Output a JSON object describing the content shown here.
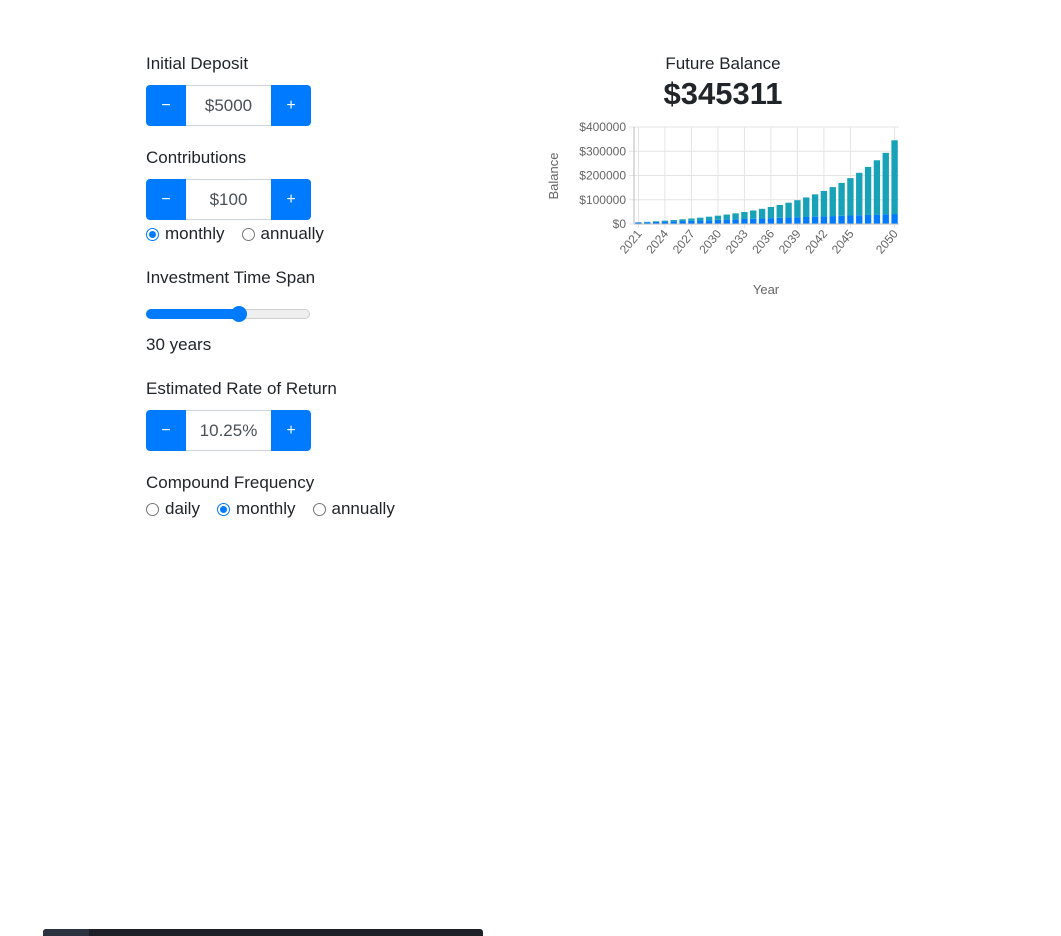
{
  "initial_deposit": {
    "label": "Initial Deposit",
    "value": "$5000",
    "minus_label": "−",
    "plus_label": "+"
  },
  "contributions": {
    "label": "Contributions",
    "value": "$100",
    "minus_label": "−",
    "plus_label": "+",
    "frequency_options": [
      "monthly",
      "annually"
    ],
    "selected_frequency": "monthly"
  },
  "time_span": {
    "label": "Investment Time Span",
    "years": 30,
    "value_text": "30 years",
    "slider_fraction": 0.56
  },
  "rate_of_return": {
    "label": "Estimated Rate of Return",
    "value": "10.25%",
    "minus_label": "−",
    "plus_label": "+"
  },
  "compound_frequency": {
    "label": "Compound Frequency",
    "options": [
      "daily",
      "monthly",
      "annually"
    ],
    "selected": "monthly"
  },
  "summary": {
    "label": "Future Balance",
    "value": "$345311"
  },
  "colors": {
    "accent": "#007bff",
    "principal_series": "#007bff",
    "interest_series": "#17a2b8"
  },
  "chart_data": {
    "type": "bar",
    "stacked": true,
    "xlabel": "Year",
    "ylabel": "Balance",
    "ylim": [
      0,
      400000
    ],
    "y_ticks": [
      "$0",
      "$100000",
      "$200000",
      "$300000",
      "$400000"
    ],
    "y_tick_values": [
      0,
      100000,
      200000,
      300000,
      400000
    ],
    "x_tick_labels": [
      "2021",
      "2024",
      "2027",
      "2030",
      "2033",
      "2036",
      "2039",
      "2042",
      "2045",
      "2050"
    ],
    "x_tick_categories": [
      "2021",
      "2024",
      "2027",
      "2030",
      "2033",
      "2036",
      "2039",
      "2042",
      "2045",
      "2050"
    ],
    "categories": [
      "2021",
      "2022",
      "2023",
      "2024",
      "2025",
      "2026",
      "2027",
      "2028",
      "2029",
      "2030",
      "2031",
      "2032",
      "2033",
      "2034",
      "2035",
      "2036",
      "2037",
      "2038",
      "2039",
      "2040",
      "2041",
      "2042",
      "2043",
      "2044",
      "2045",
      "2046",
      "2047",
      "2048",
      "2049",
      "2050"
    ],
    "series": [
      {
        "values": [
          6200,
          7400,
          8600,
          9800,
          11000,
          12200,
          13400,
          14600,
          15800,
          17000,
          18200,
          19400,
          20600,
          21800,
          23000,
          24200,
          25400,
          26600,
          27800,
          29000,
          30200,
          31400,
          32600,
          33800,
          35000,
          36200,
          37400,
          38600,
          39800,
          41000
        ]
      },
      {
        "values": [
          700,
          1600,
          2700,
          4000,
          5500,
          7300,
          9300,
          11600,
          14300,
          17300,
          20700,
          24600,
          29000,
          34000,
          39600,
          46000,
          53100,
          61200,
          70300,
          80500,
          92000,
          104900,
          119500,
          135800,
          154200,
          174900,
          198100,
          224200,
          253600,
          304311
        ]
      }
    ],
    "grid": true,
    "legend": "none"
  }
}
